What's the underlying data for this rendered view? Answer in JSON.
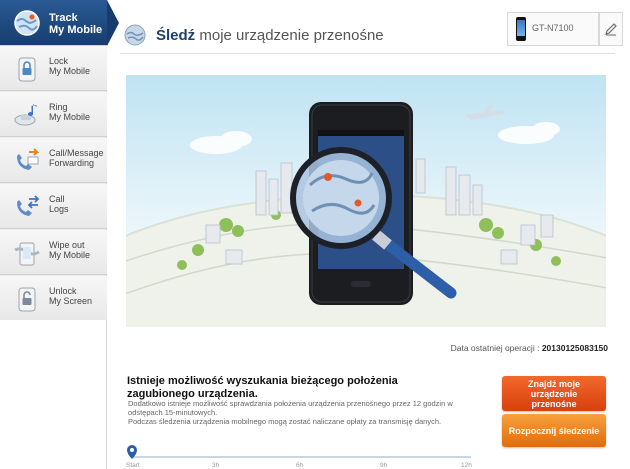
{
  "sidebar": {
    "items": [
      {
        "label_line1": "Track",
        "label_line2": "My Mobile",
        "icon": "globe-icon",
        "active": true
      },
      {
        "label_line1": "Lock",
        "label_line2": "My Mobile",
        "icon": "lock-icon",
        "active": false
      },
      {
        "label_line1": "Ring",
        "label_line2": "My Mobile",
        "icon": "ring-icon",
        "active": false
      },
      {
        "label_line1": "Call/Message",
        "label_line2": "Forwarding",
        "icon": "forwarding-icon",
        "active": false
      },
      {
        "label_line1": "Call",
        "label_line2": "Logs",
        "icon": "call-logs-icon",
        "active": false
      },
      {
        "label_line1": "Wipe out",
        "label_line2": "My Mobile",
        "icon": "wipe-icon",
        "active": false
      },
      {
        "label_line1": "Unlock",
        "label_line2": "My Screen",
        "icon": "unlock-icon",
        "active": false
      }
    ]
  },
  "header": {
    "title_bold": "Śledź",
    "title_rest": " moje urządzenie przenośne",
    "device_name": "GT-N7100"
  },
  "meta": {
    "last_op_label": "Data ostatniej operacji :",
    "last_op_value": "20130125083150"
  },
  "info": {
    "title": "Istnieje możliwość wyszukania bieżącego położenia zagubionego urządzenia.",
    "desc1": "Dodatkowo istnieje możliwość sprawdzania położenia urządzenia przenośnego przez 12 godzin w odstępach 15-minutowych.",
    "desc2": "Podczas śledzenia urządzenia mobilnego mogą zostać naliczane opłaty za transmisję danych."
  },
  "buttons": {
    "find": "Znajdź moje urządzenie przenośne",
    "track": "Rozpocznij śledzenie"
  },
  "timeline": {
    "labels": [
      "Start",
      "3h",
      "6h",
      "9h",
      "12h"
    ]
  },
  "colors": {
    "accent_dark_blue": "#173d6e",
    "find_orange": "#e04e15",
    "track_orange": "#f08a24"
  }
}
